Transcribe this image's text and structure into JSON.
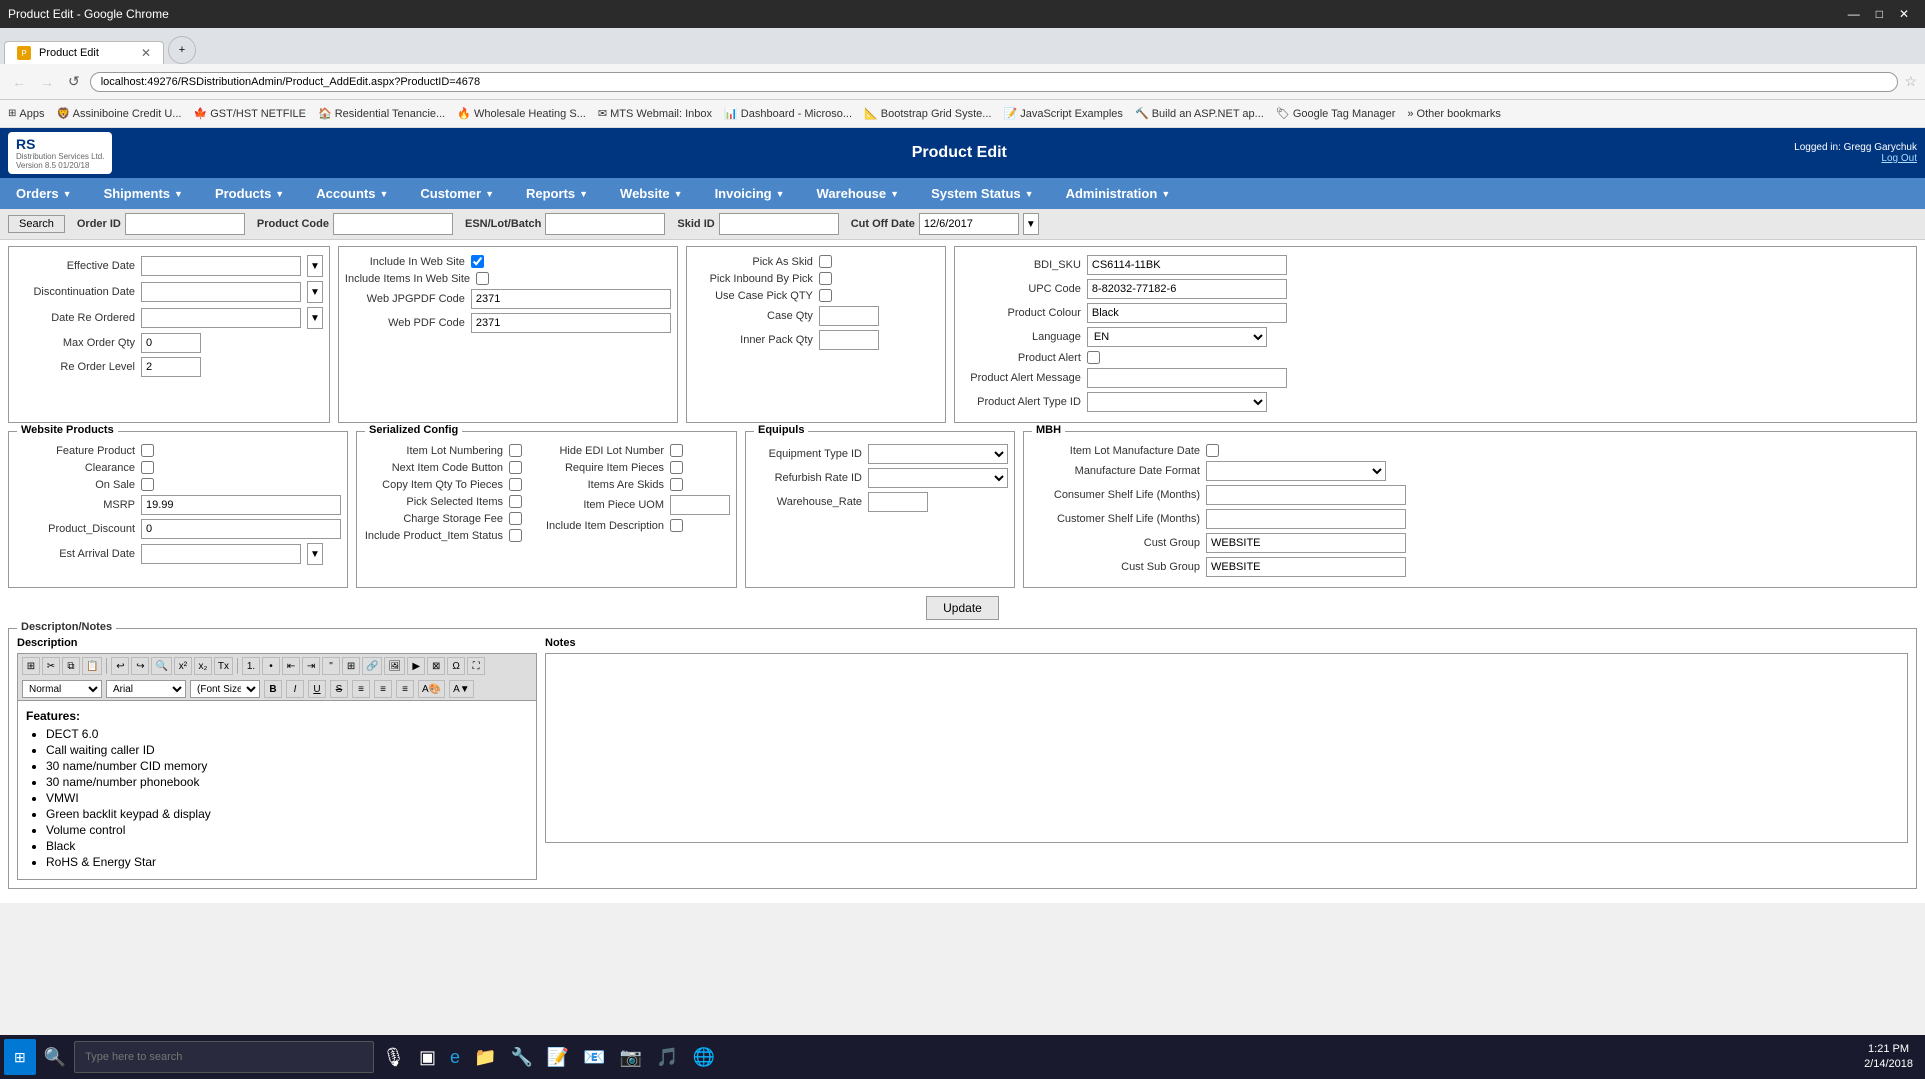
{
  "browser": {
    "tab_title": "Product Edit",
    "address": "localhost:49276/RSDistributionAdmin/Product_AddEdit.aspx?ProductID=4678",
    "bookmarks": [
      "Apps",
      "Assiniboine Credit U...",
      "GST/HST NETFILE",
      "Residential Tenancie...",
      "Wholesale Heating S...",
      "MTS Webmail: Inbox",
      "Dashboard - Microso...",
      "Bootstrap Grid Syste...",
      "JavaScript Examples",
      "Build an ASP.NET ap...",
      "Google Tag Manager",
      "Other bookmarks"
    ]
  },
  "app": {
    "title": "Product Edit",
    "logo_line1": "RS",
    "logo_line2": "Distribution Services Ltd.",
    "version": "Version 8.5 01/20/18",
    "user": "Logged in: Gregg Garychuk",
    "logout": "Log Out"
  },
  "nav": {
    "items": [
      {
        "label": "Orders",
        "has_dropdown": true
      },
      {
        "label": "Shipments",
        "has_dropdown": true
      },
      {
        "label": "Products",
        "has_dropdown": true
      },
      {
        "label": "Accounts",
        "has_dropdown": true
      },
      {
        "label": "Customer",
        "has_dropdown": true
      },
      {
        "label": "Reports",
        "has_dropdown": true
      },
      {
        "label": "Website",
        "has_dropdown": true
      },
      {
        "label": "Invoicing",
        "has_dropdown": true
      },
      {
        "label": "Warehouse",
        "has_dropdown": true
      },
      {
        "label": "System Status",
        "has_dropdown": true
      },
      {
        "label": "Administration",
        "has_dropdown": true
      }
    ]
  },
  "search_bar": {
    "search_label": "Search",
    "order_id_label": "Order ID",
    "product_code_label": "Product Code",
    "esn_label": "ESN/Lot/Batch",
    "skid_id_label": "Skid ID",
    "cut_off_date_label": "Cut Off Date",
    "cut_off_date_value": "12/6/2017"
  },
  "form": {
    "effective_date_label": "Effective Date",
    "discontinuation_date_label": "Discontinuation Date",
    "date_re_ordered_label": "Date Re Ordered",
    "max_order_qty_label": "Max Order Qty",
    "max_order_qty_value": "0",
    "re_order_level_label": "Re Order Level",
    "re_order_level_value": "2",
    "include_in_web_site_label": "Include In Web Site",
    "include_items_label": "Include Items In Web Site",
    "web_jpgpdf_label": "Web JPGPDF Code",
    "web_jpgpdf_value": "2371",
    "web_pdf_label": "Web PDF Code",
    "web_pdf_value": "2371",
    "pick_as_skid_label": "Pick As Skid",
    "pick_inbound_label": "Pick Inbound By Pick",
    "use_case_pick_label": "Use Case Pick QTY",
    "case_qty_label": "Case Qty",
    "inner_pack_label": "Inner Pack Qty",
    "bdi_sku_label": "BDI_SKU",
    "bdi_sku_value": "CS6114-11BK",
    "upc_code_label": "UPC Code",
    "upc_code_value": "8-82032-77182-6",
    "product_colour_label": "Product Colour",
    "product_colour_value": "Black",
    "language_label": "Language",
    "language_value": "EN",
    "product_alert_label": "Product Alert",
    "product_alert_msg_label": "Product Alert Message",
    "product_alert_type_label": "Product Alert Type ID",
    "website_products_title": "Website Products",
    "feature_product_label": "Feature Product",
    "clearance_label": "Clearance",
    "on_sale_label": "On Sale",
    "msrp_label": "MSRP",
    "msrp_value": "19.99",
    "product_discount_label": "Product_Discount",
    "product_discount_value": "0",
    "est_arrival_label": "Est Arrival Date",
    "serialized_config_title": "Serialized Config",
    "item_lot_numbering_label": "Item Lot Numbering",
    "next_item_code_label": "Next Item Code Button",
    "copy_item_qty_label": "Copy Item Qty To Pieces",
    "pick_selected_label": "Pick Selected Items",
    "charge_storage_label": "Charge Storage Fee",
    "include_product_status_label": "Include Product_Item Status",
    "hide_edi_lot_label": "Hide EDI Lot Number",
    "require_item_pieces_label": "Require Item Pieces",
    "items_are_skids_label": "Items Are Skids",
    "item_piece_uom_label": "Item Piece UOM",
    "include_item_desc_label": "Include Item Description",
    "equipuls_title": "Equipuls",
    "equipment_type_label": "Equipment Type ID",
    "refurbish_rate_label": "Refurbish Rate ID",
    "warehouse_rate_label": "Warehouse_Rate",
    "mbh_title": "MBH",
    "item_lot_mfr_date_label": "Item Lot Manufacture Date",
    "mfr_date_format_label": "Manufacture Date Format",
    "consumer_shelf_label": "Consumer Shelf Life (Months)",
    "customer_shelf_label": "Customer Shelf Life (Months)",
    "cust_group_label": "Cust Group",
    "cust_group_value": "WEBSITE",
    "cust_sub_group_label": "Cust Sub Group",
    "cust_sub_group_value": "WEBSITE",
    "update_btn": "Update",
    "desc_notes_title": "Descripton/Notes",
    "description_label": "Description",
    "notes_label": "Notes",
    "rte_style": "Normal",
    "rte_font": "Arial",
    "rte_font_size": "(Font Size)",
    "features_heading": "Features:",
    "features": [
      "DECT 6.0",
      "Call waiting caller ID",
      "30 name/number CID memory",
      "30 name/number phonebook",
      "VMWI",
      "Green backlit keypad & display",
      "Volume control",
      "Black",
      "RoHS & Energy Star"
    ]
  },
  "taskbar": {
    "search_placeholder": "Type here to search",
    "time": "1:21 PM",
    "date": "2/14/2018"
  }
}
